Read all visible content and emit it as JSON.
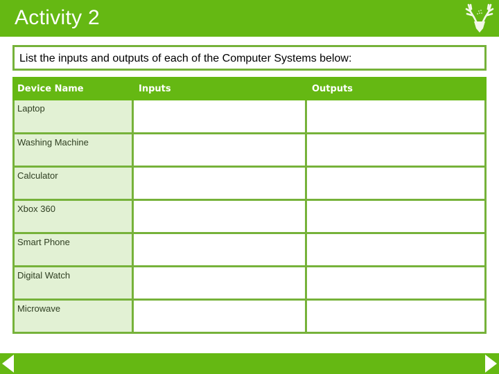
{
  "header": {
    "title": "Activity 2",
    "logo_icon": "stag-head-icon"
  },
  "instruction": "List the inputs and outputs of each of the Computer Systems below:",
  "table": {
    "columns": [
      "Device Name",
      "Inputs",
      "Outputs"
    ],
    "rows": [
      {
        "device": "Laptop",
        "inputs": "",
        "outputs": ""
      },
      {
        "device": "Washing Machine",
        "inputs": "",
        "outputs": ""
      },
      {
        "device": "Calculator",
        "inputs": "",
        "outputs": ""
      },
      {
        "device": "Xbox 360",
        "inputs": "",
        "outputs": ""
      },
      {
        "device": "Smart Phone",
        "inputs": "",
        "outputs": ""
      },
      {
        "device": "Digital Watch",
        "inputs": "",
        "outputs": ""
      },
      {
        "device": "Microwave",
        "inputs": "",
        "outputs": ""
      }
    ]
  },
  "footer": {
    "prev_icon": "triangle-left-icon",
    "next_icon": "triangle-right-icon"
  },
  "colors": {
    "brand_green": "#65b813",
    "border_green": "#76b23a",
    "device_cell_bg": "#e2f1d4"
  }
}
